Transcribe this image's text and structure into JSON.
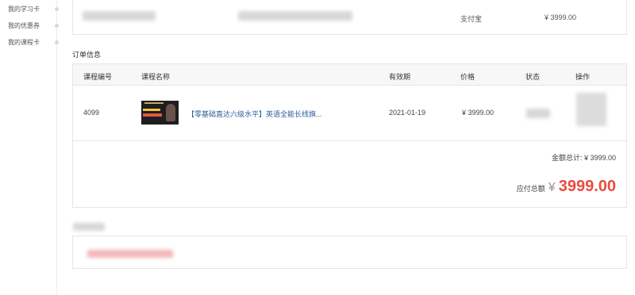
{
  "sidebar": {
    "items": [
      {
        "label": "我的学习卡"
      },
      {
        "label": "我的优惠券"
      },
      {
        "label": "我的课程卡"
      }
    ]
  },
  "payment": {
    "method": "支付宝",
    "amount": "¥ 3999.00"
  },
  "order": {
    "section_title": "订单信息",
    "columns": [
      "课程编号",
      "课程名称",
      "有效期",
      "价格",
      "状态",
      "操作"
    ],
    "rows": [
      {
        "id": "4099",
        "name": "【零基础直达六级水平】英语全能长线旗...",
        "expiry": "2021-01-19",
        "price": "¥ 3999.00"
      }
    ],
    "total_label": "金额总计: ¥ 3999.00",
    "due_label": "应付总额",
    "due_currency": "¥",
    "due_amount": "3999.00"
  },
  "colors": {
    "accent_red": "#e84c3d",
    "link_blue": "#2a5d97"
  },
  "icons": [
    "course-thumbnail"
  ]
}
